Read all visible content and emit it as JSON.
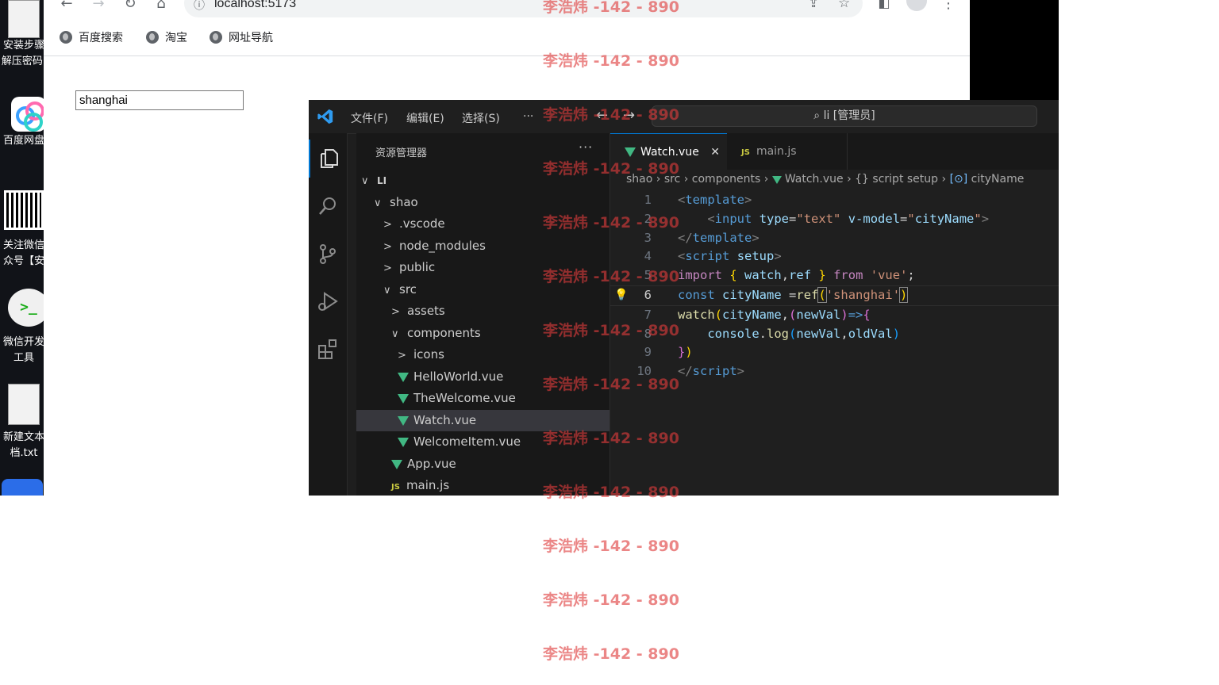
{
  "desktop": {
    "icons": [
      {
        "label1": "安装步骤",
        "label2": "解压密码.",
        "kind": "doc"
      },
      {
        "label1": "百度网盘",
        "label2": "",
        "kind": "baidu"
      },
      {
        "label1": "关注微信",
        "label2": "众号【安",
        "kind": "qr"
      },
      {
        "label1": "微信开发",
        "label2": "工具",
        "kind": "wechat-dev"
      },
      {
        "label1": "新建文本",
        "label2": "档.txt",
        "kind": "doc"
      }
    ]
  },
  "browser": {
    "url": "localhost:5173",
    "bookmarks": [
      "百度搜索",
      "淘宝",
      "网址导航"
    ],
    "input_value": "shanghai"
  },
  "vscode": {
    "menus": [
      "文件(F)",
      "编辑(E)",
      "选择(S)",
      "···"
    ],
    "command_center": "li [管理员]",
    "explorer_title": "资源管理器",
    "explorer_more": "···",
    "tree": [
      {
        "label": "LI",
        "chev": "∨",
        "indent": 0,
        "icon": "none",
        "bold": true
      },
      {
        "label": "shao",
        "chev": "∨",
        "indent": 1,
        "icon": "none"
      },
      {
        "label": ".vscode",
        "chev": ">",
        "indent": 2,
        "icon": "none"
      },
      {
        "label": "node_modules",
        "chev": ">",
        "indent": 2,
        "icon": "none"
      },
      {
        "label": "public",
        "chev": ">",
        "indent": 2,
        "icon": "none"
      },
      {
        "label": "src",
        "chev": "∨",
        "indent": 2,
        "icon": "none"
      },
      {
        "label": "assets",
        "chev": ">",
        "indent": 3,
        "icon": "none"
      },
      {
        "label": "components",
        "chev": "∨",
        "indent": 3,
        "icon": "none"
      },
      {
        "label": "icons",
        "chev": ">",
        "indent": 4,
        "icon": "none"
      },
      {
        "label": "HelloWorld.vue",
        "chev": "",
        "indent": 4,
        "icon": "vue"
      },
      {
        "label": "TheWelcome.vue",
        "chev": "",
        "indent": 4,
        "icon": "vue"
      },
      {
        "label": "Watch.vue",
        "chev": "",
        "indent": 4,
        "icon": "vue",
        "selected": true
      },
      {
        "label": "WelcomeItem.vue",
        "chev": "",
        "indent": 4,
        "icon": "vue"
      },
      {
        "label": "App.vue",
        "chev": "",
        "indent": 3,
        "icon": "vue"
      },
      {
        "label": "main.js",
        "chev": "",
        "indent": 3,
        "icon": "js"
      }
    ],
    "tabs": [
      {
        "label": "Watch.vue",
        "icon": "vue",
        "active": true,
        "close": "✕"
      },
      {
        "label": "main.js",
        "icon": "js",
        "active": false
      }
    ],
    "breadcrumbs": [
      "shao",
      "src",
      "components",
      "Watch.vue",
      "script setup",
      "cityName"
    ],
    "code_lines": [
      "1",
      "2",
      "3",
      "4",
      "5",
      "6",
      "7",
      "8",
      "9",
      "10"
    ],
    "current_line": "6"
  },
  "watermark": {
    "text": "李浩炜 -142 - 890"
  }
}
